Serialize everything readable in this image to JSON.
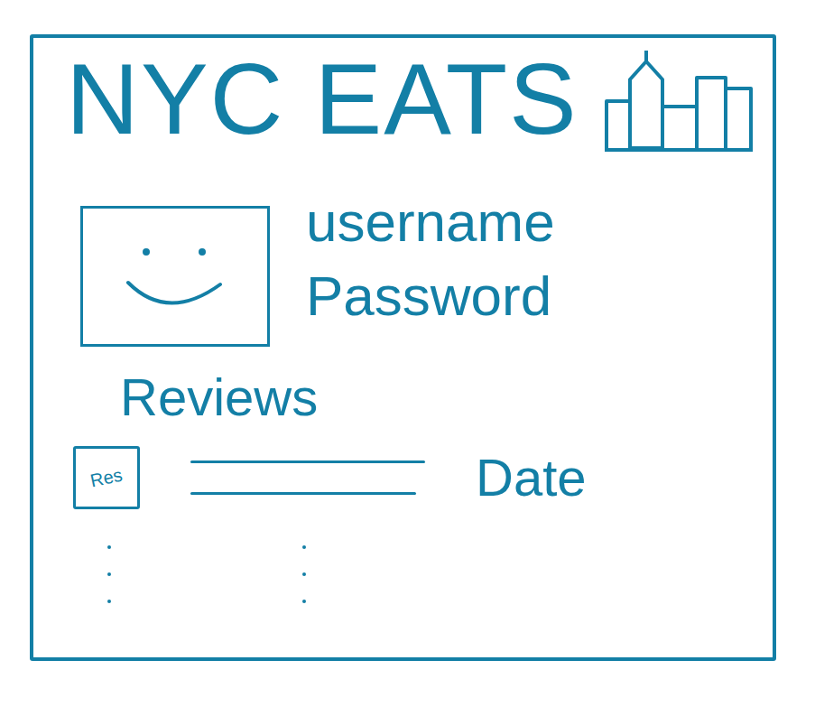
{
  "app": {
    "title": "NYC EATS"
  },
  "profile": {
    "fields": [
      "username",
      "Password"
    ]
  },
  "reviews": {
    "heading": "Reviews",
    "rows": [
      {
        "badge": "Res",
        "date": "Date"
      }
    ],
    "more": true
  }
}
